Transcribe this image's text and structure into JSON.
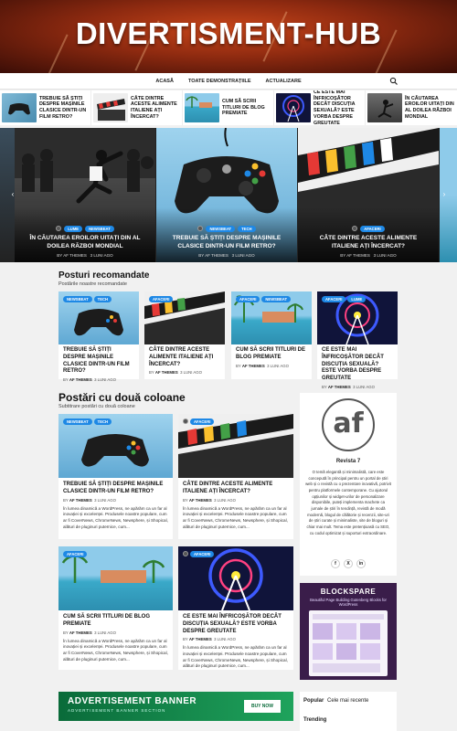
{
  "site": {
    "title": "DIVERTISMENT-HUB"
  },
  "nav": {
    "items": [
      "ACASĂ",
      "TOATE DEMONSTRAȚIILE",
      "ACTUALIZARE"
    ]
  },
  "ticker": [
    {
      "title": "TREBUIE SĂ ȘTIȚI DESPRE MAȘINILE CLASICE DINTR-UN FILM RETRO?"
    },
    {
      "title": "CÂTE DINTRE ACESTE ALIMENTE ITALIENE AȚI ÎNCERCAT?"
    },
    {
      "title": "CUM SĂ SCRII TITLURI DE BLOG PREMIATE"
    },
    {
      "title": "CE ESTE MAI ÎNFRICOȘĂTOR DECÂT DISCUȚIA SEXUALĂ? ESTE VORBA DESPRE GREUTATE"
    },
    {
      "title": "ÎN CĂUTAREA EROILOR UITAȚI DIN AL DOILEA RĂZBOI MONDIAL"
    }
  ],
  "slider": [
    {
      "cats": [
        "LUME",
        "NEWSBEAT"
      ],
      "title": "ÎN CĂUTAREA EROILOR UITAȚI DIN AL DOILEA RĂZBOI MONDIAL",
      "author": "BY AF THEMES",
      "date": "3 LUNI AGO"
    },
    {
      "cats": [
        "NEWSBEAT",
        "TECH"
      ],
      "title": "TREBUIE SĂ ȘTIȚI DESPRE MAȘINILE CLASICE DINTR-UN FILM RETRO?",
      "author": "BY AF THEMES",
      "date": "3 LUNI AGO"
    },
    {
      "cats": [
        "AFACERI"
      ],
      "title": "CÂTE DINTRE ACESTE ALIMENTE ITALIENE AȚI ÎNCERCAT?",
      "author": "BY AF THEMES",
      "date": "3 LUNI AGO"
    }
  ],
  "recommended": {
    "title": "Posturi recomandate",
    "subtitle": "Postările noastre recomandate",
    "posts": [
      {
        "cats": [
          "NEWSBEAT",
          "TECH"
        ],
        "title": "TREBUIE SĂ ȘTIȚI DESPRE MAȘINILE CLASICE DINTR-UN FILM RETRO?",
        "author": "AF THEMES",
        "date": "3 LUNI AGO"
      },
      {
        "cats": [
          "AFACERI"
        ],
        "title": "CÂTE DINTRE ACESTE ALIMENTE ITALIENE AȚI ÎNCERCAT?",
        "author": "AF THEMES",
        "date": "3 LUNI AGO"
      },
      {
        "cats": [
          "AFACERI",
          "NEWSBEAT"
        ],
        "title": "CUM SĂ SCRII TITLURI DE BLOG PREMIATE",
        "author": "AF THEMES",
        "date": "3 LUNI AGO"
      },
      {
        "cats": [
          "AFACERI",
          "LUME"
        ],
        "title": "CE ESTE MAI ÎNFRICOȘĂTOR DECÂT DISCUȚIA SEXUALĂ? ESTE VORBA DESPRE GREUTATE",
        "author": "AF THEMES",
        "date": "3 LUNI AGO"
      }
    ]
  },
  "two_col": {
    "title": "Postări cu două coloane",
    "subtitle": "Subtitrare postări cu două coloane",
    "posts": [
      {
        "cats": [
          "NEWSBEAT",
          "TECH"
        ],
        "title": "TREBUIE SĂ ȘTIȚI DESPRE MAȘINILE CLASICE DINTR-UN FILM RETRO?",
        "author": "AF THEMES",
        "date": "3 LUNI AGO",
        "excerpt": "În lumea dinamică a WordPress, ne apărăm ca un far al inovației și excelenței. Produsele noastre populare, cum ar fi CoverNews, ChromeNews, Newsphere, și Shopical, alături de pluginuri puternice, cum..."
      },
      {
        "cats": [
          "AFACERI"
        ],
        "title": "CÂTE DINTRE ACESTE ALIMENTE ITALIENE AȚI ÎNCERCAT?",
        "author": "AF THEMES",
        "date": "3 LUNI AGO",
        "excerpt": "În lumea dinamică a WordPress, ne apărăm ca un far al inovației și excelenței. Produsele noastre populare, cum ar fi CoverNews, ChromeNews, Newsphere, și Shopical, alături de pluginuri puternice, cum..."
      },
      {
        "cats": [
          "AFACERI"
        ],
        "title": "CUM SĂ SCRII TITLURI DE BLOG PREMIATE",
        "author": "AF THEMES",
        "date": "3 LUNI AGO",
        "excerpt": "În lumea dinamică a WordPress, ne apărăm ca un far al inovației și excelenței. Produsele noastre populare, cum ar fi CoverNews, ChromeNews, Newsphere, și Shopical, alături de pluginuri puternice, cum..."
      },
      {
        "cats": [
          "AFACERI"
        ],
        "title": "CE ESTE MAI ÎNFRICOȘĂTOR DECÂT DISCUȚIA SEXUALĂ? ESTE VORBA DESPRE GREUTATE",
        "author": "AF THEMES",
        "date": "3 LUNI AGO",
        "excerpt": "În lumea dinamică a WordPress, ne apărăm ca un far al inovației și excelenței. Produsele noastre populare, cum ar fi CoverNews, ChromeNews, Newsphere, și Shopical, alături de pluginuri puternice, cum..."
      }
    ]
  },
  "author_widget": {
    "logo": "af",
    "name": "Revista 7",
    "text": "O temă elegantă și minimalistă, care este concepută în principal pentru un portal de știri web și o revistă cu o prezentare inovativă, potrivit pentru platformele contemporane. Cu ajutorul opțiunilor și widget-urilor de personalizare disponibile, puteți implementa machete ca jurnale de știri în tendință, revistă de modă modernă, blogul de călătorie și recenzii, site-uri de știri curate și minimaliste, site de bloguri și chiar mai mult. Tema este pretențioasă cu SEO, cu codul optimizat și suporturi extraordinare.",
    "social": [
      "f",
      "X",
      "in"
    ]
  },
  "blockspare": {
    "brand": "BLOCKSPARE",
    "tagline": "Beautiful Page Building Gutenberg Blocks for WordPress"
  },
  "ad": {
    "title": "ADVERTISEMENT BANNER",
    "subtitle": "ADVERTISEMENT BANNER SECTION",
    "button": "BUY NOW"
  },
  "tabs": {
    "popular": "Popular",
    "recent": "Cele mai recente",
    "trending": "Trending"
  },
  "by_label": "BY",
  "colors": {
    "accent": "#1e88e5",
    "header_red": "#8e2a10"
  }
}
